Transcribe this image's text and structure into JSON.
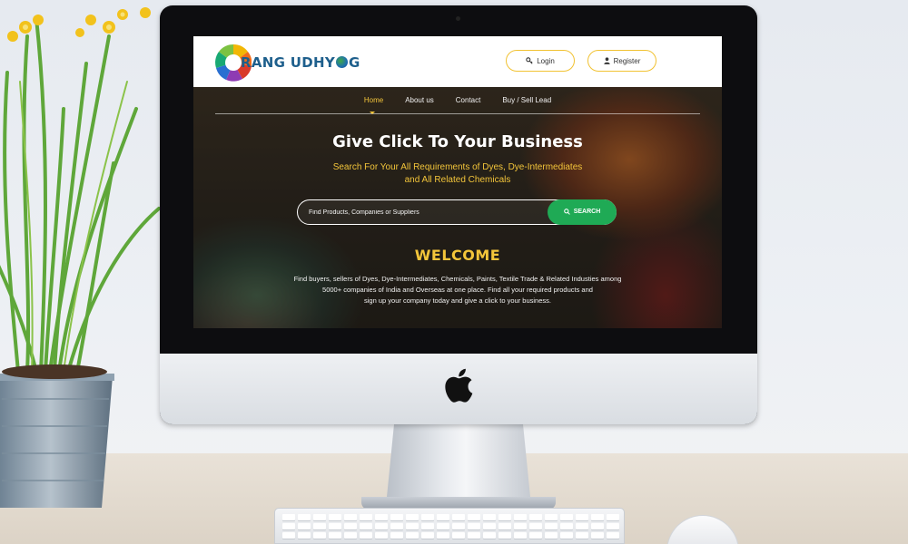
{
  "site": {
    "brand": {
      "text_before": "RANG UDHY",
      "text_after": "G"
    },
    "header": {
      "login_label": "Login",
      "register_label": "Register"
    },
    "nav": {
      "items": [
        {
          "label": "Home",
          "active": true
        },
        {
          "label": "About us",
          "active": false
        },
        {
          "label": "Contact",
          "active": false
        },
        {
          "label": "Buy / Sell Lead",
          "active": false
        }
      ]
    },
    "hero": {
      "title": "Give Click To Your Business",
      "subtitle_line1": "Search For Your All Requirements of Dyes, Dye-Intermediates",
      "subtitle_line2": "and All Related Chemicals"
    },
    "search": {
      "placeholder": "Find Products, Companies or Suppliers",
      "button_label": "SEARCH"
    },
    "welcome": {
      "heading": "WELCOME",
      "line1": "Find buyers, sellers of Dyes, Dye-Intermediates, Chemicals, Paints, Textile Trade & Related Industies among",
      "line2": "5000+ companies of India and Overseas at one place. Find all your required products and",
      "line3": "sign up your company today and give a click to your business."
    }
  },
  "colors": {
    "accent": "#f3c53a",
    "search_button": "#1faa55",
    "brand_text": "#1e5f8c",
    "header_bg": "#ffffff"
  },
  "icons": [
    "user-key-icon",
    "user-icon",
    "search-icon",
    "apple-logo-icon",
    "globe-icon"
  ]
}
